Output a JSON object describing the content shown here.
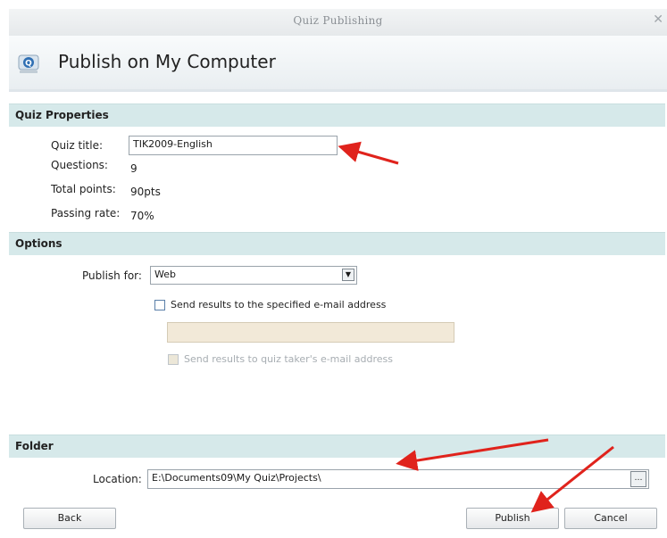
{
  "window": {
    "title": "Quiz Publishing",
    "close_icon": "close-icon"
  },
  "header": {
    "title": "Publish on My Computer",
    "icon": "quiz-publish-icon",
    "icon_letter": "Q"
  },
  "quiz_properties": {
    "heading": "Quiz Properties",
    "title_label": "Quiz title:",
    "title_value": "TIK2009-English",
    "questions_label": "Questions:",
    "questions_value": "9",
    "points_label": "Total points:",
    "points_value": "90pts",
    "passing_label": "Passing rate:",
    "passing_value": "70%"
  },
  "options": {
    "heading": "Options",
    "publish_for_label": "Publish for:",
    "publish_for_value": "Web",
    "send_results_label": "Send results to the specified e-mail address",
    "send_results_checked": false,
    "email_value": "",
    "send_taker_label": "Send results to quiz taker's e-mail address",
    "send_taker_checked": false
  },
  "folder": {
    "heading": "Folder",
    "location_label": "Location:",
    "location_value": "E:\\Documents09\\My Quiz\\Projects\\"
  },
  "buttons": {
    "back": "Back",
    "publish": "Publish",
    "cancel": "Cancel"
  },
  "colors": {
    "section_bar": "#d6e9ea",
    "annotation_arrow": "#e0231c",
    "disabled_field": "#f2e9d8"
  }
}
